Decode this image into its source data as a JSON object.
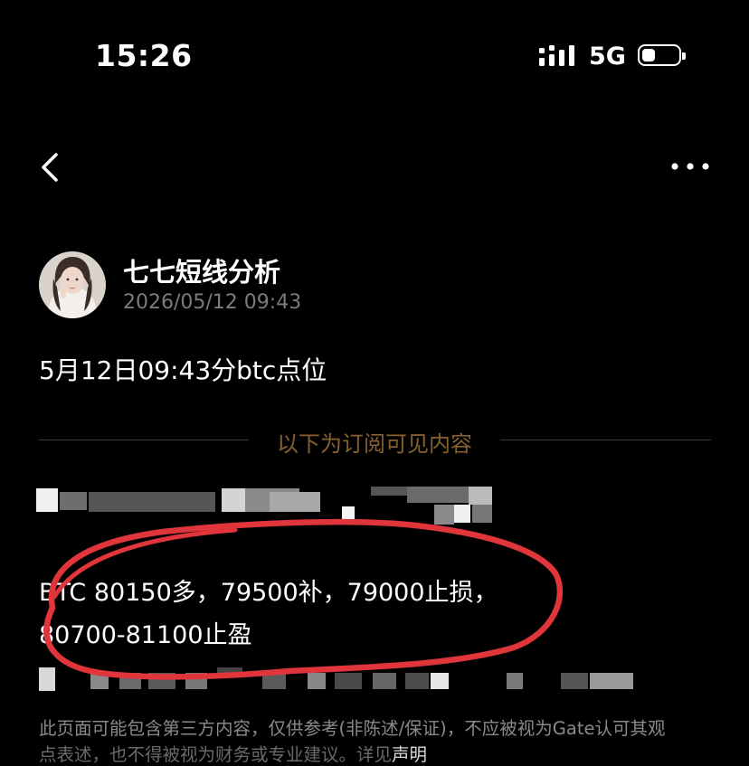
{
  "status_bar": {
    "time": "15:26",
    "network": "5G",
    "signal_icon": "signal-bars-icon",
    "battery_icon": "battery-icon"
  },
  "nav": {
    "back_icon": "back-chevron-icon",
    "more_icon": "more-dots-icon"
  },
  "author": {
    "name": "七七短线分析",
    "timestamp": "2026/05/12 09:43"
  },
  "post": {
    "title": "5月12日09:43分btc点位",
    "subscribe_divider": "以下为订阅可见内容",
    "line_2": "BTC 80150多，79500补，79000止损，",
    "line_3": "80700-81100止盈"
  },
  "disclaimer": {
    "text": "此页面可能包含第三方内容，仅供参考(非陈述/保证)，不应被视为Gate认可其观",
    "line2": "点表述，也不得被视为财务或专业建议。详见",
    "link": "声明"
  },
  "colors": {
    "background": "#000000",
    "divider_text": "#86602e",
    "annotation": "#e0353a"
  }
}
